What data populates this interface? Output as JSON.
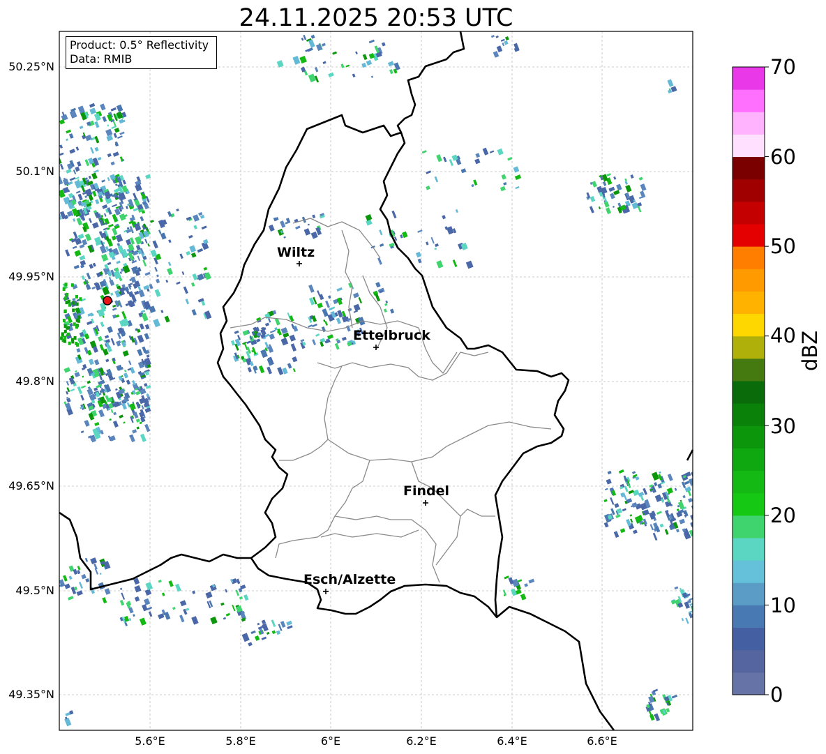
{
  "title": "24.11.2025 20:53 UTC",
  "info": {
    "product": "Product: 0.5° Reflectivity",
    "data": "Data: RMIB"
  },
  "axes": {
    "y_ticks": [
      "50.25°N",
      "50.1°N",
      "49.95°N",
      "49.8°N",
      "49.65°N",
      "49.5°N",
      "49.35°N"
    ],
    "x_ticks": [
      "5.6°E",
      "5.8°E",
      "6°E",
      "6.2°E",
      "6.4°E",
      "6.6°E"
    ]
  },
  "cities": [
    {
      "name": "Wiltz"
    },
    {
      "name": "Ettelbruck"
    },
    {
      "name": "Findel"
    },
    {
      "name": "Esch/Alzette"
    }
  ],
  "radar_site_color": "#e8151b",
  "colorbar": {
    "label": "dBZ",
    "ticks": [
      "0",
      "10",
      "20",
      "30",
      "40",
      "50",
      "60",
      "70"
    ],
    "colors": [
      "#6673a6",
      "#5565a0",
      "#445fa2",
      "#4879b2",
      "#5a9cc5",
      "#64c1d9",
      "#5bd6c2",
      "#3fd46e",
      "#14c814",
      "#14b914",
      "#10a810",
      "#0c960c",
      "#0a820a",
      "#0a6b0a",
      "#447a10",
      "#b0b00a",
      "#ffd700",
      "#ffb300",
      "#ff9a00",
      "#ff7e00",
      "#e40000",
      "#c40000",
      "#a00000",
      "#7a0000",
      "#ffe0ff",
      "#ffb3ff",
      "#ff70ff",
      "#e838e8"
    ]
  }
}
